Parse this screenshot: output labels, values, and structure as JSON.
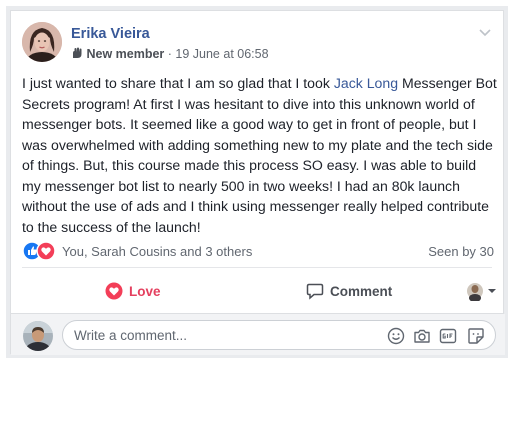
{
  "post": {
    "author": "Erika Vieira",
    "badge": "New member",
    "date": " · 19 June at 06:58",
    "text_1": "I just wanted to share that I am so glad that I took ",
    "link": "Jack Long",
    "text_2": " Messenger Bot Secrets program! At first I was hesitant to dive into this unknown world of messenger bots. It seemed like a good way to get in front of people, but I was overwhelmed with adding something new to my plate and the tech side of things. But, this course made this process SO easy. I was able to build my messenger bot list to nearly 500 in two weeks! I had an 80k launch without the use of ads and I think using messenger really helped contribute to the success of the launch!"
  },
  "reactions": {
    "summary": "You, Sarah Cousins and 3 others",
    "seen": "Seen by 30",
    "icons": [
      "like-icon",
      "love-icon"
    ]
  },
  "actions": {
    "love": "Love",
    "comment": "Comment"
  },
  "composer": {
    "placeholder": "Write a comment...",
    "icons": [
      "emoji-icon",
      "camera-icon",
      "gif-icon",
      "sticker-icon"
    ]
  },
  "colors": {
    "link": "#385898",
    "love": "#e4405f",
    "like": "#1877f2",
    "text": "#1d2129",
    "muted": "#616770"
  }
}
